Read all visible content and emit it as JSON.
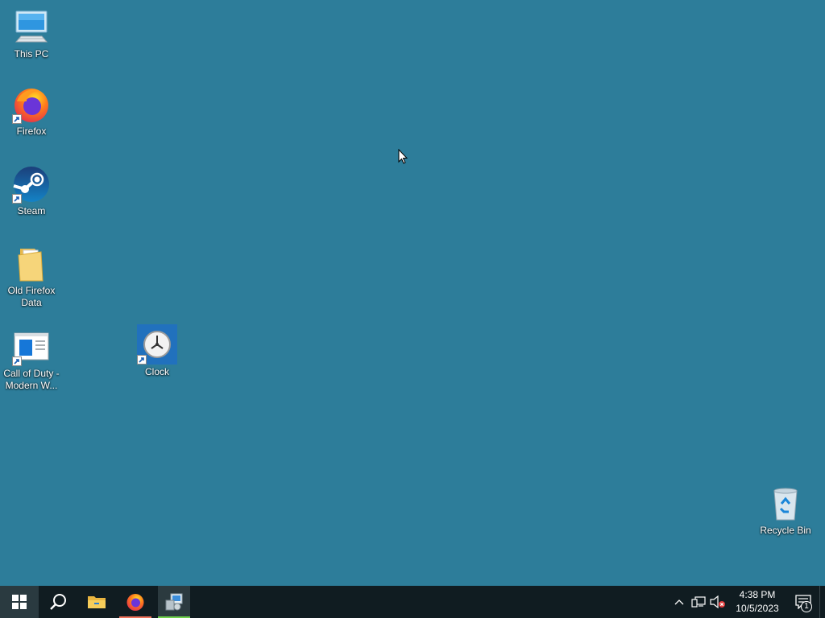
{
  "desktop": {
    "icons": [
      {
        "label": "This PC",
        "icon": "computer-icon"
      },
      {
        "label": "Firefox",
        "icon": "firefox-icon",
        "shortcut": true
      },
      {
        "label": "Steam",
        "icon": "steam-icon",
        "shortcut": true
      },
      {
        "label": "Old Firefox\nData",
        "icon": "folder-icon"
      },
      {
        "label": "Call of Duty -\nModern W...",
        "icon": "app-window-icon",
        "shortcut": true
      },
      {
        "label": "Clock",
        "icon": "clock-icon",
        "shortcut": true,
        "selected": true
      },
      {
        "label": "Recycle Bin",
        "icon": "recycle-bin-icon"
      }
    ]
  },
  "taskbar": {
    "buttons": [
      "windows-start-icon",
      "search-icon",
      "file-explorer-icon",
      "firefox-icon",
      "app-installer-icon"
    ],
    "tray": {
      "time": "4:38 PM",
      "date": "10/5/2023",
      "notification_count": "1",
      "icons": [
        "chevron-up-icon",
        "network-icon",
        "volume-muted-icon",
        "notification-icon"
      ]
    }
  },
  "colors": {
    "desktop_background": "#2d7d9a",
    "taskbar": "#101c21",
    "firefox_indicator": "#f0735c",
    "active_indicator": "#6fd14c"
  }
}
